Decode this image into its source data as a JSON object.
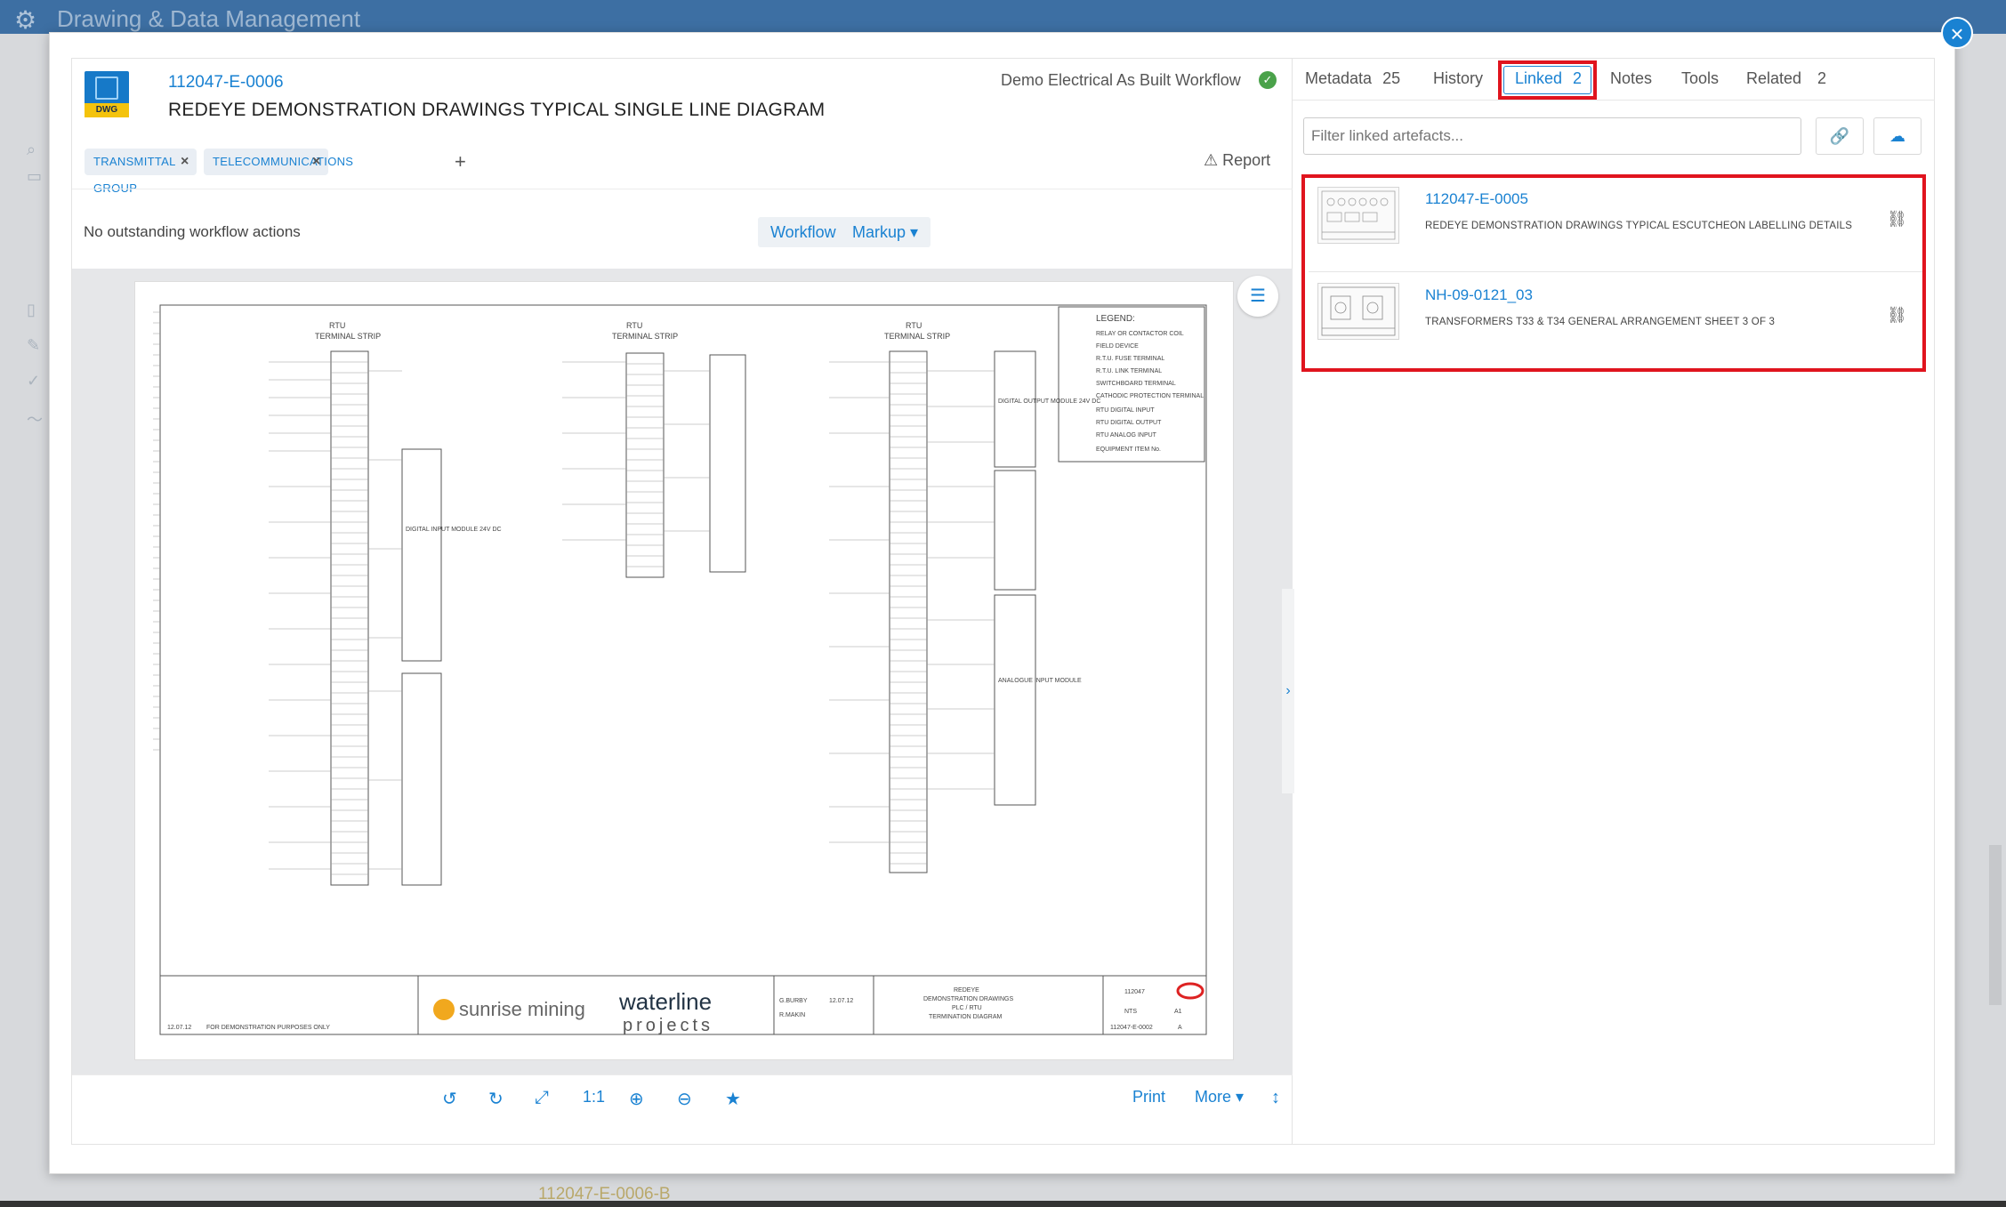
{
  "background": {
    "app_title": "Drawing & Data Management",
    "footer_doc": "112047-E-0006-B"
  },
  "document": {
    "number": "112047-E-0006",
    "title": "REDEYE DEMONSTRATION DRAWINGS TYPICAL SINGLE LINE DIAGRAM",
    "file_type": "DWG",
    "workflow_name": "Demo Electrical As Built Workflow",
    "tags": [
      {
        "label": "TRANSMITTAL GROUP"
      },
      {
        "label": "TELECOMMUNICATIONS"
      }
    ],
    "report_label": "Report",
    "workflow_status": "No outstanding workflow actions",
    "workflow_button": "Workflow",
    "markup_button": "Markup"
  },
  "drawing": {
    "section_labels": [
      "RTU",
      "TERMINAL STRIP"
    ],
    "module_labels": [
      "DIGITAL INPUT MODULE 24V DC",
      "DIGITAL OUTPUT MODULE 24V DC",
      "ANALOGUE INPUT MODULE"
    ],
    "legend_title": "LEGEND:",
    "legend_items": [
      "RELAY OR CONTACTOR COIL",
      "FIELD DEVICE",
      "R.T.U. FUSE TERMINAL",
      "R.T.U. LINK TERMINAL",
      "SWITCHBOARD TERMINAL",
      "CATHODIC PROTECTION TERMINAL",
      "RTU DIGITAL INPUT",
      "RTU DIGITAL OUTPUT",
      "RTU ANALOG INPUT",
      "EQUIPMENT ITEM No."
    ],
    "title_block": {
      "client_logo": "sunrise mining",
      "contractor_logo_top": "waterline",
      "contractor_logo_bottom": "projects",
      "drawing_title_lines": [
        "REDEYE",
        "DEMONSTRATION DRAWINGS",
        "PLC / RTU",
        "TERMINATION DIAGRAM"
      ],
      "job_code": "112047",
      "scale": "NTS",
      "sheet": "A1",
      "drawing_no": "112047-E-0002",
      "rev": "A",
      "revision_note": "FOR DEMONSTRATION PURPOSES ONLY",
      "revision_date": "12.07.12",
      "drawn": "G.BURBY",
      "approved": "R.MAKIN",
      "date": "12.07.12"
    }
  },
  "viewer_toolbar": {
    "zoom_label": "1:1",
    "print_label": "Print",
    "more_label": "More"
  },
  "tabs": [
    {
      "label": "Metadata",
      "count": "25"
    },
    {
      "label": "History",
      "count": ""
    },
    {
      "label": "Linked",
      "count": "2"
    },
    {
      "label": "Notes",
      "count": ""
    },
    {
      "label": "Tools",
      "count": ""
    },
    {
      "label": "Related",
      "count": "2"
    }
  ],
  "linked": {
    "filter_placeholder": "Filter linked artefacts...",
    "items": [
      {
        "number": "112047-E-0005",
        "description": "REDEYE DEMONSTRATION DRAWINGS TYPICAL ESCUTCHEON LABELLING DETAILS"
      },
      {
        "number": "NH-09-0121_03",
        "description": "TRANSFORMERS T33 & T34 GENERAL ARRANGEMENT SHEET 3 OF 3"
      }
    ]
  },
  "colors": {
    "accent": "#1a82d2",
    "highlight": "#e0141e",
    "success": "#4aa24a",
    "brand_yellow": "#f4c30c"
  }
}
